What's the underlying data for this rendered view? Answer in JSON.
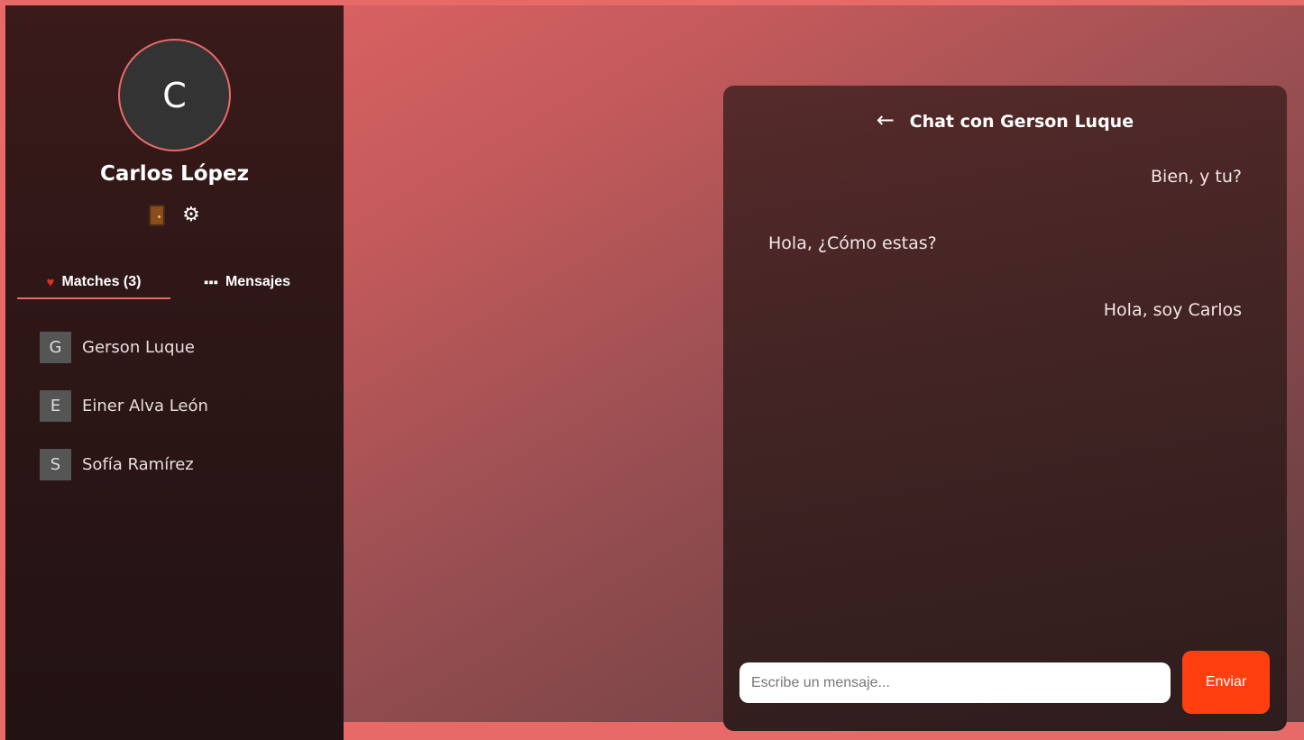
{
  "profile": {
    "initial": "C",
    "name": "Carlos López",
    "logout_icon": "door-icon",
    "settings_icon": "gear-icon"
  },
  "tabs": [
    {
      "label": "Matches (3)",
      "icon": "heart-icon",
      "active": true
    },
    {
      "label": "Mensajes",
      "icon": "speech-bubble-icon",
      "active": false
    }
  ],
  "matches": [
    {
      "initial": "G",
      "name": "Gerson Luque"
    },
    {
      "initial": "E",
      "name": "Einer Alva León"
    },
    {
      "initial": "S",
      "name": "Sofía Ramírez"
    }
  ],
  "chat": {
    "back_icon": "←",
    "title": "Chat con Gerson Luque",
    "messages": [
      {
        "text": "Bien, y tu?",
        "side": "right"
      },
      {
        "text": "Hola, ¿Cómo estas?",
        "side": "left"
      },
      {
        "text": "Hola, soy Carlos",
        "side": "right"
      }
    ],
    "input_placeholder": "Escribe un mensaje...",
    "send_label": "Enviar"
  },
  "colors": {
    "accent": "#e86a68",
    "send_button": "#ff3f0f"
  }
}
